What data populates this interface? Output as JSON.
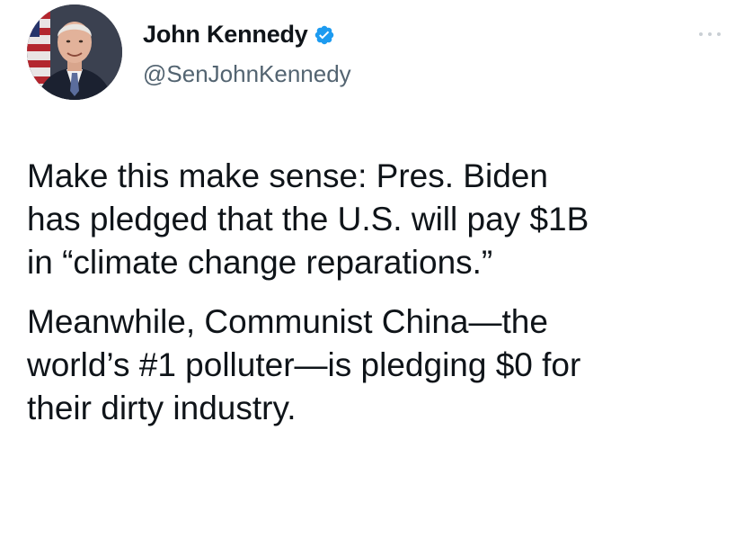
{
  "author": {
    "display_name": "John Kennedy",
    "handle": "@SenJohnKennedy",
    "verified": true,
    "avatar_icon": "profile-photo",
    "verified_color": "#1d9bf0"
  },
  "menu": {
    "icon": "more-options-icon"
  },
  "tweet": {
    "paragraph_1": "Make this make sense: Pres. Biden\nhas pledged that the U.S. will pay $1B\nin “climate change reparations.”",
    "paragraph_2": "Meanwhile, Communist China—the\nworld’s #1 polluter—is pledging $0 for\ntheir dirty industry."
  }
}
